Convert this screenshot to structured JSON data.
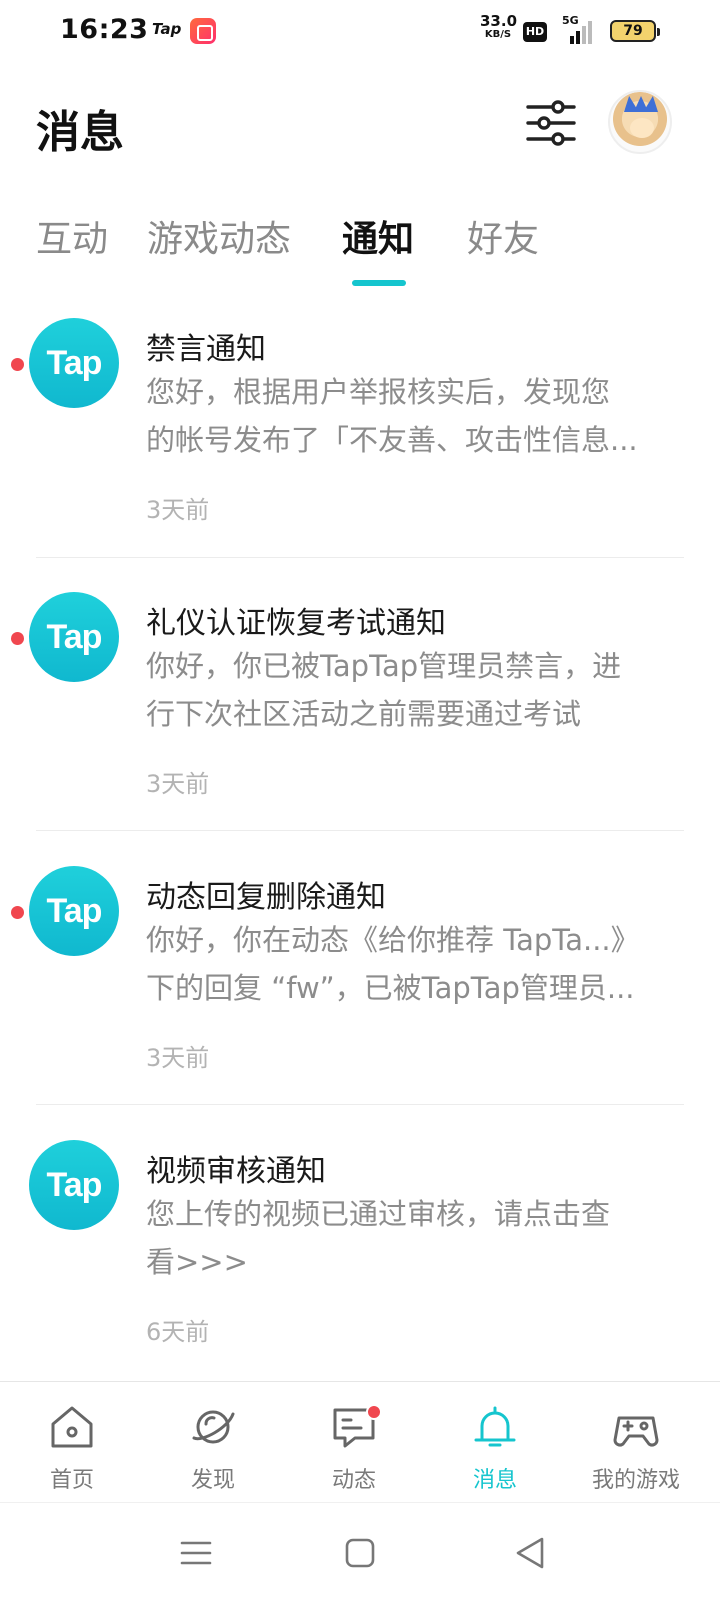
{
  "status_bar": {
    "time": "16:23",
    "app_label": "Tap",
    "net_speed_value": "33.0",
    "net_speed_unit": "KB/S",
    "hd_label": "HD",
    "network": "5G",
    "battery": "79"
  },
  "header": {
    "title": "消息",
    "filter_icon": "sliders-icon",
    "avatar_icon": "user-avatar"
  },
  "tabs": [
    {
      "label": "互动",
      "active": false
    },
    {
      "label": "游戏动态",
      "active": false
    },
    {
      "label": "通知",
      "active": true
    },
    {
      "label": "好友",
      "active": false
    }
  ],
  "notifications": [
    {
      "logo": "Tap",
      "title": "禁言通知",
      "body_lines": [
        "您好，根据用户举报核实后，发现您",
        "的帐号发布了「不友善、攻击性信息..."
      ],
      "time": "3天前",
      "unread": true
    },
    {
      "logo": "Tap",
      "title": "礼仪认证恢复考试通知",
      "body_lines": [
        "你好，你已被TapTap管理员禁言，进",
        "行下次社区活动之前需要通过考试"
      ],
      "time": "3天前",
      "unread": true
    },
    {
      "logo": "Tap",
      "title": "动态回复删除通知",
      "body_lines": [
        "你好，你在动态《给你推荐 TapTa...》",
        "下的回复 “fw”，已被TapTap管理员..."
      ],
      "time": "3天前",
      "unread": true
    },
    {
      "logo": "Tap",
      "title": "视频审核通知",
      "body_lines": [
        "您上传的视频已通过审核，请点击查",
        "看>>>"
      ],
      "time": "6天前",
      "unread": false
    }
  ],
  "bottom_nav": [
    {
      "label": "首页",
      "icon": "home-icon",
      "active": false
    },
    {
      "label": "发现",
      "icon": "planet-icon",
      "active": false
    },
    {
      "label": "动态",
      "icon": "chat-icon",
      "active": false,
      "badge": true
    },
    {
      "label": "消息",
      "icon": "bell-icon",
      "active": true
    },
    {
      "label": "我的游戏",
      "icon": "gamepad-icon",
      "active": false
    }
  ],
  "colors": {
    "accent": "#15c5ce",
    "unread_dot": "#f0474f",
    "secondary_text": "#8c8c8c"
  }
}
